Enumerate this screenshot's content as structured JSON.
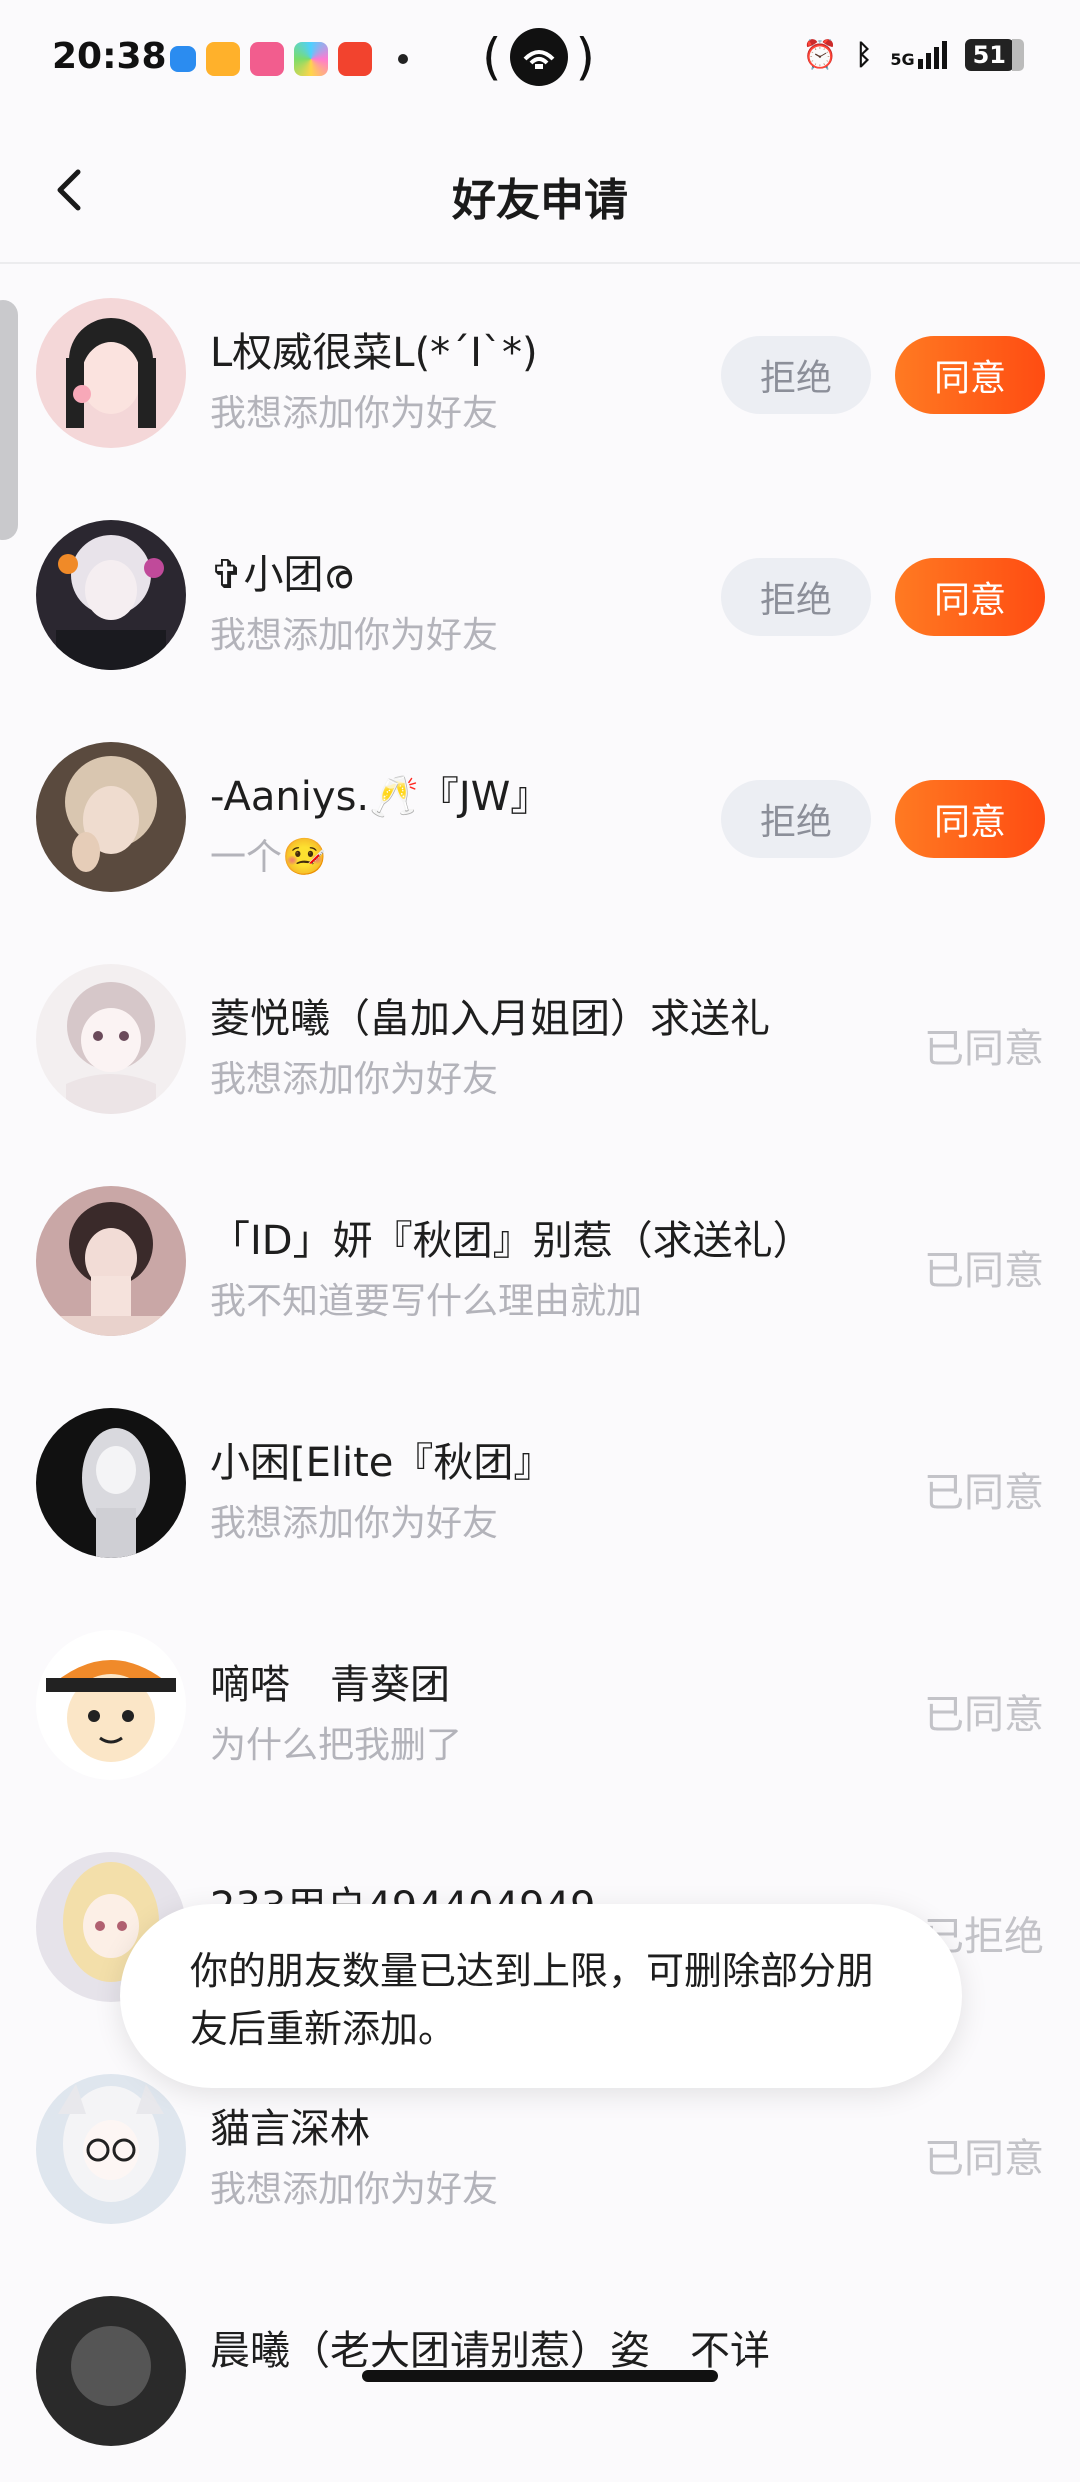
{
  "status_bar": {
    "time": "20:38",
    "battery": "51",
    "signal_label": "5G",
    "icons": [
      "app-icon-blue",
      "app-icon-video-orange",
      "app-icon-bilibili",
      "app-icon-multicolor",
      "app-icon-play-red",
      "dot"
    ]
  },
  "header": {
    "title": "好友申请",
    "back_icon": "back-chevron-icon"
  },
  "requests": [
    {
      "name": "L权威很菜L(*´I`*)",
      "message": "我想添加你为好友",
      "status": "pending"
    },
    {
      "name": "✞小团ര",
      "message": "我想添加你为好友",
      "status": "pending"
    },
    {
      "name": "-Aaniys.🥂『JW』",
      "message": "一个🤒",
      "status": "pending"
    },
    {
      "name": "菱悦曦（畠加入月姐团）求送礼",
      "message": "我想添加你为好友",
      "status": "accepted"
    },
    {
      "name": "「ID」妍『秋团』别惹（求送礼）",
      "message": "我不知道要写什么理由就加",
      "status": "accepted"
    },
    {
      "name": "小困[Elite『秋团』",
      "message": "我想添加你为好友",
      "status": "accepted"
    },
    {
      "name": "嘀嗒　青葵团",
      "message": "为什么把我删了",
      "status": "accepted"
    },
    {
      "name": "233用户494404949",
      "message": "",
      "status": "rejected"
    },
    {
      "name": "貓言深林",
      "message": "我想添加你为好友",
      "status": "accepted"
    },
    {
      "name": "晨曦（老大团请别惹）姿　不详",
      "message": "",
      "status": "none"
    }
  ],
  "labels": {
    "reject": "拒绝",
    "accept": "同意",
    "accepted": "已同意",
    "rejected": "已拒绝"
  },
  "toast": {
    "text": "你的朋友数量已达到上限，可删除部分朋友后重新添加。"
  },
  "colors": {
    "accent": "#ff5a16",
    "muted_text": "#b3b3ba",
    "state_text": "#c3c3c8"
  }
}
